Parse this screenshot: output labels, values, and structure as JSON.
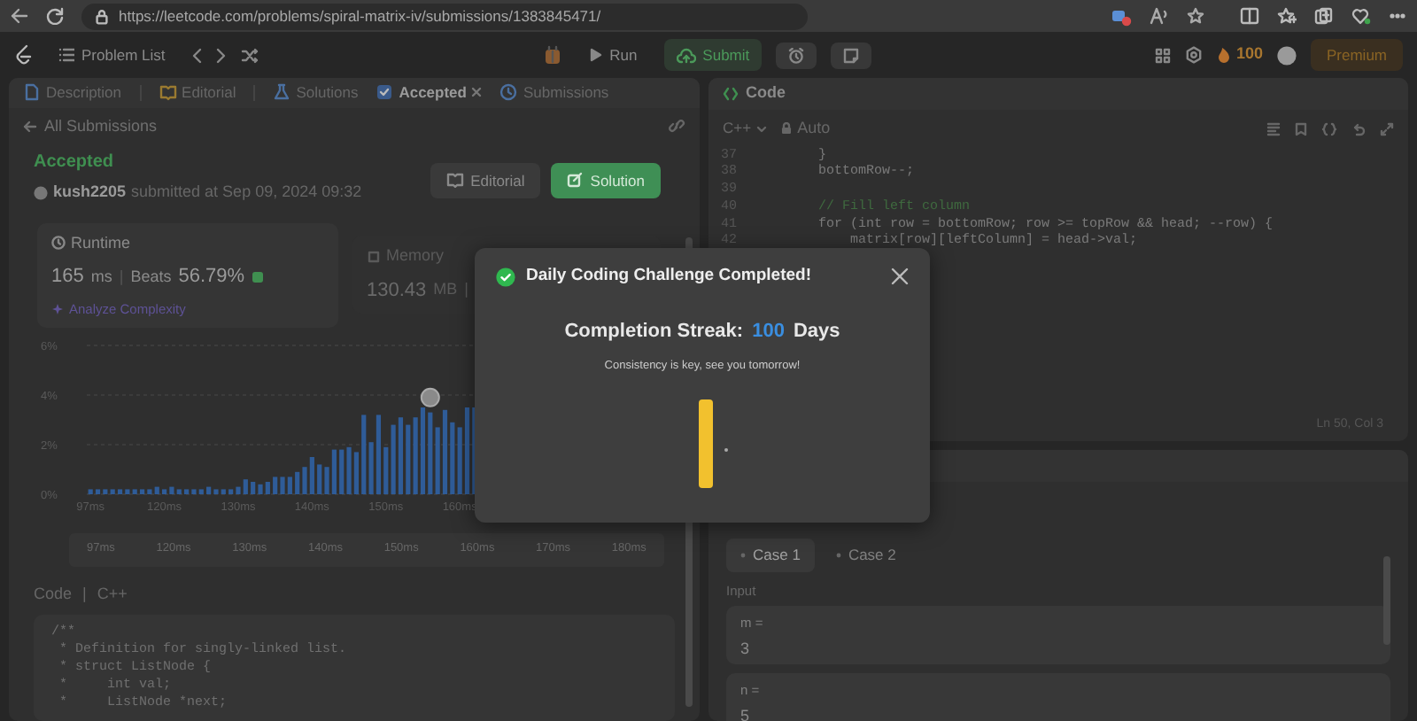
{
  "browser": {
    "url": "https://leetcode.com/problems/spiral-matrix-iv/submissions/1383845471/"
  },
  "header": {
    "problem_list": "Problem List",
    "run": "Run",
    "submit": "Submit",
    "streak": "100",
    "premium": "Premium"
  },
  "left_tabs": [
    {
      "label": "Description",
      "selected": false,
      "closable": false
    },
    {
      "label": "Editorial",
      "selected": false,
      "closable": false
    },
    {
      "label": "Solutions",
      "selected": false,
      "closable": false
    },
    {
      "label": "Accepted",
      "selected": true,
      "closable": true
    },
    {
      "label": "Submissions",
      "selected": false,
      "closable": false
    }
  ],
  "submission": {
    "back": "All Submissions",
    "status": "Accepted",
    "user": "kush2205",
    "submitted": "submitted at Sep 09, 2024 09:32",
    "buttons": [
      {
        "label": "Editorial",
        "kind": "plain"
      },
      {
        "label": "Solution",
        "kind": "primary"
      }
    ]
  },
  "runtime": {
    "title": "Runtime",
    "value": "165",
    "unit": "ms",
    "separator": "|",
    "beats_label": "Beats",
    "beats": "56.79%",
    "analyze": "Analyze Complexity"
  },
  "memory": {
    "title": "Memory",
    "value": "130.43",
    "unit": "MB",
    "separator": "|"
  },
  "runtime_chart": {
    "chart_data": {
      "type": "bar",
      "values": [
        0.2,
        0.2,
        0.2,
        0.2,
        0.2,
        0.2,
        0.2,
        0.2,
        0.2,
        0.3,
        0.2,
        0.3,
        0.2,
        0.2,
        0.2,
        0.2,
        0.3,
        0.2,
        0.2,
        0.2,
        0.3,
        0.6,
        0.5,
        0.4,
        0.5,
        0.7,
        0.7,
        0.7,
        0.9,
        1.1,
        1.5,
        1.2,
        1.1,
        1.8,
        1.8,
        1.9,
        1.7,
        3.2,
        2.1,
        3.2,
        1.9,
        2.8,
        3.1,
        2.8,
        3.1,
        3.5,
        3.3,
        2.7,
        3.4,
        2.9,
        2.7,
        3.5,
        3.5
      ],
      "ylim": [
        0,
        6
      ],
      "yticks": [
        {
          "value": 0,
          "label": "0%"
        },
        {
          "value": 2,
          "label": "2%"
        },
        {
          "value": 4,
          "label": "4%"
        },
        {
          "value": 6,
          "label": "6%"
        }
      ]
    },
    "x_labels": [
      "97ms",
      "120ms",
      "130ms",
      "140ms",
      "150ms",
      "160ms"
    ],
    "range_labels": [
      "97ms",
      "120ms",
      "130ms",
      "140ms",
      "150ms",
      "160ms",
      "170ms",
      "180ms"
    ]
  },
  "code_section": {
    "title": "Code",
    "separator": "|",
    "language": "C++",
    "lines": [
      "/**",
      " * Definition for singly-linked list.",
      " * struct ListNode {",
      " *     int val;",
      " *     ListNode *next;"
    ]
  },
  "editor": {
    "title": "Code",
    "language": "C++",
    "mode": "Auto",
    "lines": [
      {
        "number": "37",
        "kind": "code",
        "text": "        }"
      },
      {
        "number": "38",
        "kind": "code",
        "text": "        bottomRow--;"
      },
      {
        "number": "39"
      },
      {
        "number": "40",
        "kind": "comment",
        "text": "        // Fill left column"
      },
      {
        "number": "41",
        "kind": "code",
        "text": "        for (int row = bottomRow; row >= topRow && head; --row) {"
      },
      {
        "number": "42",
        "kind": "code",
        "text": "            matrix[row][leftColumn] = head->val;"
      }
    ],
    "cursor": "Ln 50, Col 3"
  },
  "testcase": {
    "cases": [
      {
        "label": "Case 1",
        "selected": true
      },
      {
        "label": "Case 2",
        "selected": false
      }
    ],
    "input_label": "Input",
    "params": [
      {
        "name": "m =",
        "value": "3"
      },
      {
        "name": "n =",
        "value": "5"
      }
    ]
  },
  "modal": {
    "title": "Daily Coding Challenge Completed!",
    "streak_label": "Completion Streak:",
    "streak_value": "100",
    "streak_unit": "Days",
    "message": "Consistency is key, see you tomorrow!"
  }
}
